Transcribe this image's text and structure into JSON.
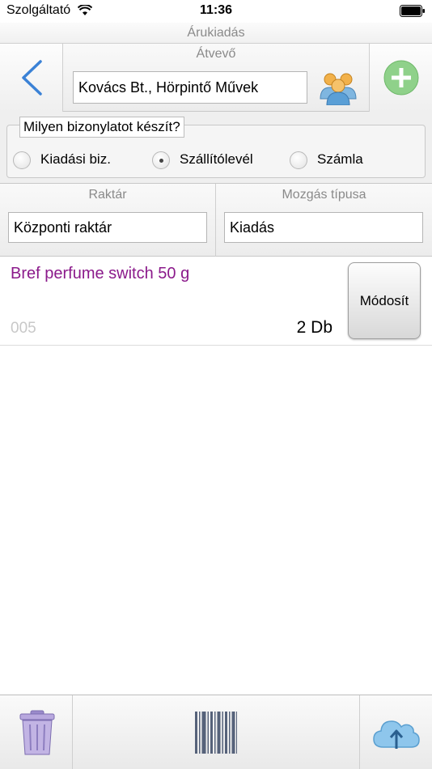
{
  "status_bar": {
    "carrier": "Szolgáltató",
    "time": "11:36",
    "battery_level": 1.0
  },
  "screen": {
    "title": "Árukiadás"
  },
  "recipient": {
    "label": "Átvevő",
    "value": "Kovács Bt., Hörpintő Művek"
  },
  "doc_type": {
    "question": "Milyen bizonylatot készít?",
    "options": [
      {
        "label": "Kiadási biz.",
        "selected": false
      },
      {
        "label": "Szállítólevél",
        "selected": true
      },
      {
        "label": "Számla",
        "selected": false
      }
    ]
  },
  "warehouse": {
    "label": "Raktár",
    "value": "Központi raktár"
  },
  "movement": {
    "label": "Mozgás típusa",
    "value": "Kiadás"
  },
  "items": [
    {
      "name": "Bref perfume switch 50 g",
      "code": "005",
      "quantity": "2 Db",
      "action_label": "Módosít"
    }
  ],
  "icons": {
    "back": "chevron-left-icon",
    "people": "people-icon",
    "add": "plus-circle-icon",
    "trash": "trash-icon",
    "barcode": "barcode-icon",
    "upload": "cloud-upload-icon"
  },
  "colors": {
    "accent_blue": "#3b82d6",
    "add_green": "#8fd18a",
    "item_name": "#8b1a8b",
    "trash_purple": "#b8a8de"
  }
}
